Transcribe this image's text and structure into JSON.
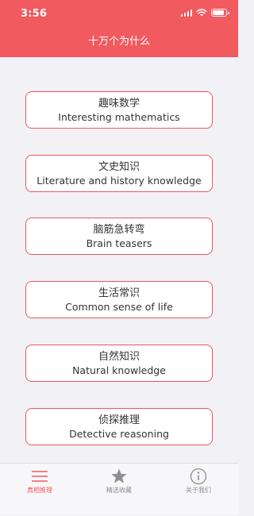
{
  "status_bar": {
    "time": "3:56"
  },
  "nav": {
    "title": "十万个为什么"
  },
  "menu": [
    {
      "cn": "趣味数学",
      "en": "Interesting mathematics"
    },
    {
      "cn": "文史知识",
      "en": "Literature and history knowledge"
    },
    {
      "cn": "脑筋急转弯",
      "en": "Brain teasers"
    },
    {
      "cn": "生活常识",
      "en": "Common sense of life"
    },
    {
      "cn": "自然知识",
      "en": "Natural knowledge"
    },
    {
      "cn": "侦探推理",
      "en": "Detective reasoning"
    }
  ],
  "tabbar": {
    "tabs": [
      {
        "label": "真相推理",
        "icon": "menu-lines-icon",
        "active": true
      },
      {
        "label": "精选收藏",
        "icon": "star-icon",
        "active": false
      },
      {
        "label": "关于我们",
        "icon": "info-icon",
        "active": false
      }
    ]
  },
  "colors": {
    "accent": "#f15a5f",
    "background": "#f2f1f6",
    "inactive_tab": "#8e8e93"
  }
}
